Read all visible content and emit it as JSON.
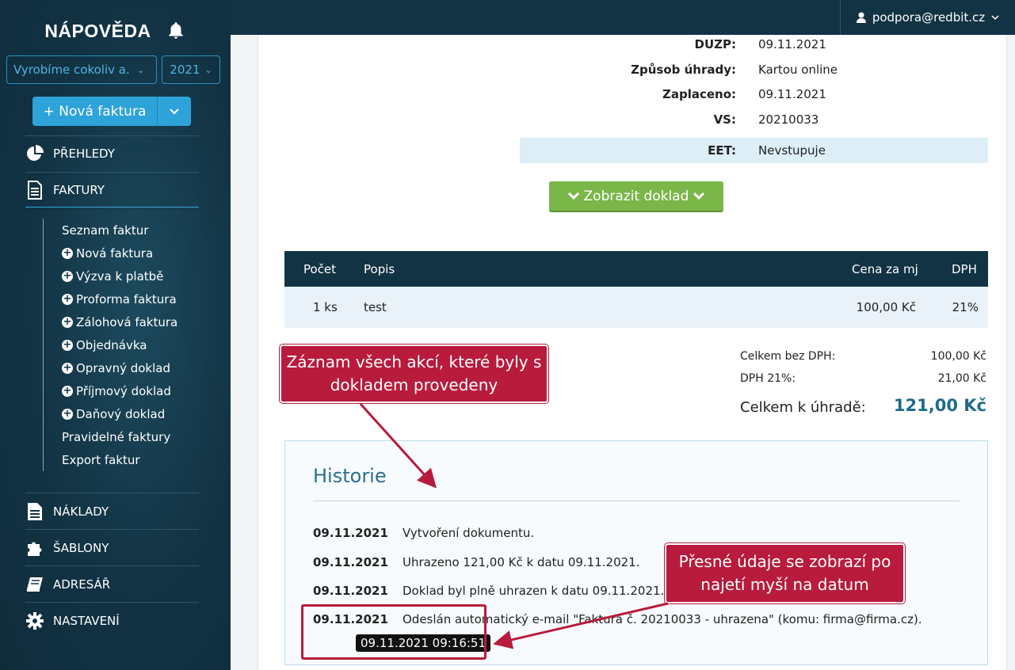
{
  "sidebar": {
    "title": "NÁPOVĚDA",
    "company_select": "Vyrobíme cokoliv a. s",
    "year_select": "2021",
    "new_invoice_label": "+ Nová faktura",
    "nav": {
      "prehledy": "PŘEHLEDY",
      "faktury": "FAKTURY",
      "naklady": "NÁKLADY",
      "sablony": "ŠABLONY",
      "adresar": "ADRESÁŘ",
      "nastaveni": "NASTAVENÍ"
    },
    "subnav": [
      "Seznam faktur",
      "Nová faktura",
      "Výzva k platbě",
      "Proforma faktura",
      "Zálohová faktura",
      "Objednávka",
      "Opravný doklad",
      "Příjmový doklad",
      "Daňový doklad",
      "Pravidelné faktury",
      "Export faktur"
    ]
  },
  "topbar": {
    "user_email": "podpora@redbit.cz"
  },
  "details": {
    "duzp_label": "DUZP:",
    "duzp_value": "09.11.2021",
    "payment_label": "Způsob úhrady:",
    "payment_value": "Kartou online",
    "paid_label": "Zaplaceno:",
    "paid_value": "09.11.2021",
    "vs_label": "VS:",
    "vs_value": "20210033",
    "eet_label": "EET:",
    "eet_value": "Nevstupuje"
  },
  "show_document_label": "Zobrazit doklad",
  "items_table": {
    "headers": {
      "count": "Počet",
      "description": "Popis",
      "unit_price": "Cena za mj",
      "vat": "DPH"
    },
    "rows": [
      {
        "count": "1 ks",
        "description": "test",
        "unit_price": "100,00 Kč",
        "vat": "21%"
      }
    ]
  },
  "totals": {
    "without_vat_label": "Celkem bez DPH:",
    "without_vat_value": "100,00 Kč",
    "vat_label": "DPH 21%:",
    "vat_value": "21,00 Kč",
    "total_label": "Celkem k úhradě:",
    "total_value": "121,00 Kč"
  },
  "history": {
    "title": "Historie",
    "entries": [
      {
        "date": "09.11.2021",
        "text": "Vytvoření dokumentu."
      },
      {
        "date": "09.11.2021",
        "text": "Uhrazeno 121,00 Kč k datu 09.11.2021."
      },
      {
        "date": "09.11.2021",
        "text": "Doklad byl plně uhrazen k datu 09.11.2021."
      },
      {
        "date": "09.11.2021",
        "text": "Odeslán automatický e-mail \"Faktura č. 20210033 - uhrazena\" (komu: firma@firma.cz)."
      }
    ],
    "tooltip": "09.11.2021 09:16:51"
  },
  "callouts": {
    "history_note": "Záznam všech akcí, které byly s dokladem provedeny",
    "hover_note": "Přesné údaje se zobrazí po najetí myší na datum"
  },
  "colors": {
    "sidebar_bg": "#123344",
    "accent_blue": "#2ea3d9",
    "green_button": "#7ab648",
    "callout_red": "#b81b3c",
    "total_amount": "#1f6b8a"
  }
}
